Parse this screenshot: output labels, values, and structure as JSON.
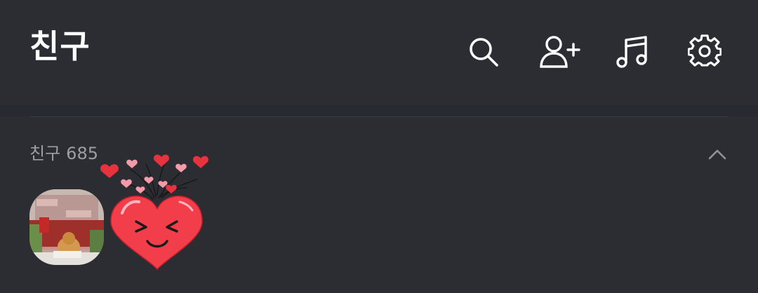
{
  "header": {
    "title": "친구",
    "icons": [
      "search-icon",
      "add-friend-icon",
      "music-icon",
      "settings-icon"
    ]
  },
  "friends_section": {
    "label": "친구",
    "count": "685",
    "collapse_icon": "chevron-up-icon"
  },
  "my_profile": {
    "avatar": "christmas-photo",
    "sticker": "heart-sticker"
  },
  "colors": {
    "background": "#2b2d33",
    "title": "#ffffff",
    "muted": "#9b9ea5",
    "divider": "#3a3d44",
    "heart": "#f23d4a"
  }
}
